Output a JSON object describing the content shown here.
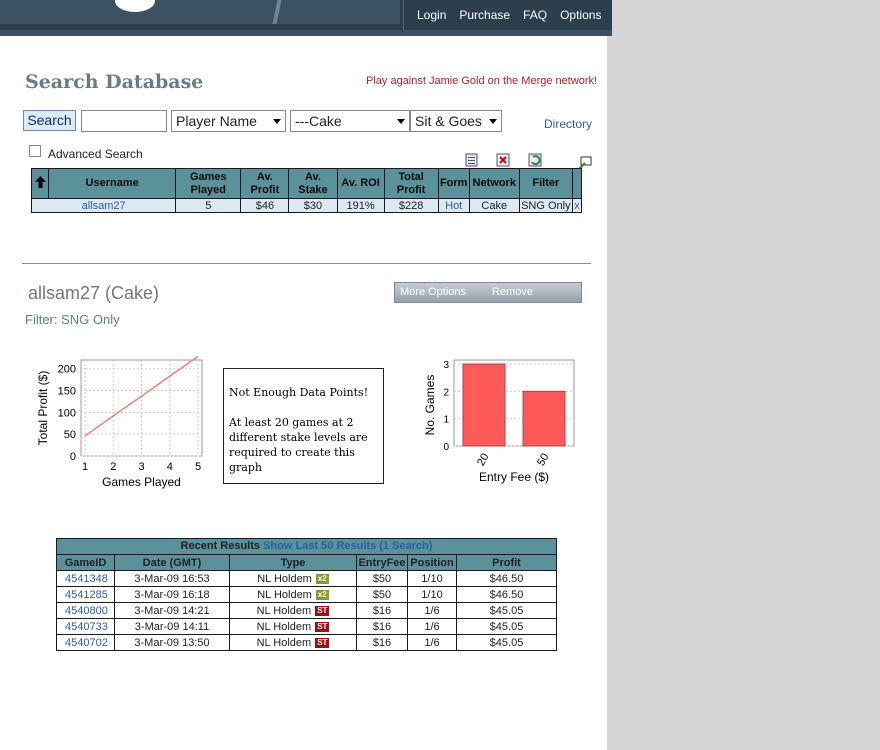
{
  "nav": {
    "items": [
      "Login",
      "Purchase",
      "FAQ",
      "Options"
    ]
  },
  "heading": "Search Database",
  "promo": "Play against Jamie Gold on the Merge network!",
  "search": {
    "button": "Search",
    "input_value": "",
    "player_select": "Player Name",
    "site_select": "---Cake",
    "game_select": "Sit & Goes",
    "directory": "Directory",
    "advanced": "Advanced Search"
  },
  "results": {
    "headers": [
      "Username",
      "Games Played",
      "Av. Profit",
      "Av. Stake",
      "Av. ROI",
      "Total Profit",
      "Form",
      "Network",
      "Filter",
      ""
    ],
    "rows": [
      [
        "allsam27",
        "5",
        "$46",
        "$30",
        "191%",
        "$228",
        "Hot",
        "Cake",
        "SNG Only",
        "x"
      ]
    ]
  },
  "player": {
    "title": "allsam27 (Cake)",
    "filter": "Filter: SNG Only",
    "more_options": "More Options",
    "remove": "Remove"
  },
  "not_enough": {
    "line1": "Not Enough Data Points!",
    "line2": "At least 20 games at 2 different stake levels are required to create this graph"
  },
  "chart_data": [
    {
      "type": "line",
      "x": [
        1,
        2,
        3,
        4,
        5
      ],
      "y": [
        46,
        92,
        137,
        183,
        228
      ],
      "xlabel": "Games Played",
      "ylabel": "Total Profit ($)",
      "xlim": [
        1,
        5
      ],
      "ylim": [
        0,
        220
      ],
      "yticks": [
        0,
        50,
        100,
        150,
        200
      ],
      "xticks": [
        1,
        2,
        3,
        4,
        5
      ],
      "color": "#f08070",
      "grid": true
    },
    {
      "type": "bar",
      "categories": [
        "20",
        "50"
      ],
      "values": [
        3,
        2
      ],
      "xlabel": "Entry Fee ($)",
      "ylabel": "No. Games",
      "ylim": [
        0,
        3
      ],
      "yticks": [
        0,
        1,
        2,
        3
      ],
      "color": "#ff5a5a",
      "grid": true
    }
  ],
  "recent": {
    "title": "Recent Results",
    "link": "Show Last 50 Results (1 Search)",
    "headers": [
      "GameID",
      "Date (GMT)",
      "Type",
      "EntryFee",
      "Position",
      "Profit"
    ],
    "rows": [
      {
        "id": "4541348",
        "date": "3-Mar-09  16:53",
        "type": "NL Holdem",
        "badge": "x2",
        "fee": "$50",
        "pos": "1/10",
        "profit": "$46.50"
      },
      {
        "id": "4541285",
        "date": "3-Mar-09  16:18",
        "type": "NL Holdem",
        "badge": "x2",
        "fee": "$50",
        "pos": "1/10",
        "profit": "$46.50"
      },
      {
        "id": "4540800",
        "date": "3-Mar-09  14:21",
        "type": "NL Holdem",
        "badge": "ST",
        "fee": "$16",
        "pos": "1/6",
        "profit": "$45.05"
      },
      {
        "id": "4540733",
        "date": "3-Mar-09  14:11",
        "type": "NL Holdem",
        "badge": "ST",
        "fee": "$16",
        "pos": "1/6",
        "profit": "$45.05"
      },
      {
        "id": "4540702",
        "date": "3-Mar-09  13:50",
        "type": "NL Holdem",
        "badge": "ST",
        "fee": "$16",
        "pos": "1/6",
        "profit": "$45.05"
      }
    ]
  }
}
